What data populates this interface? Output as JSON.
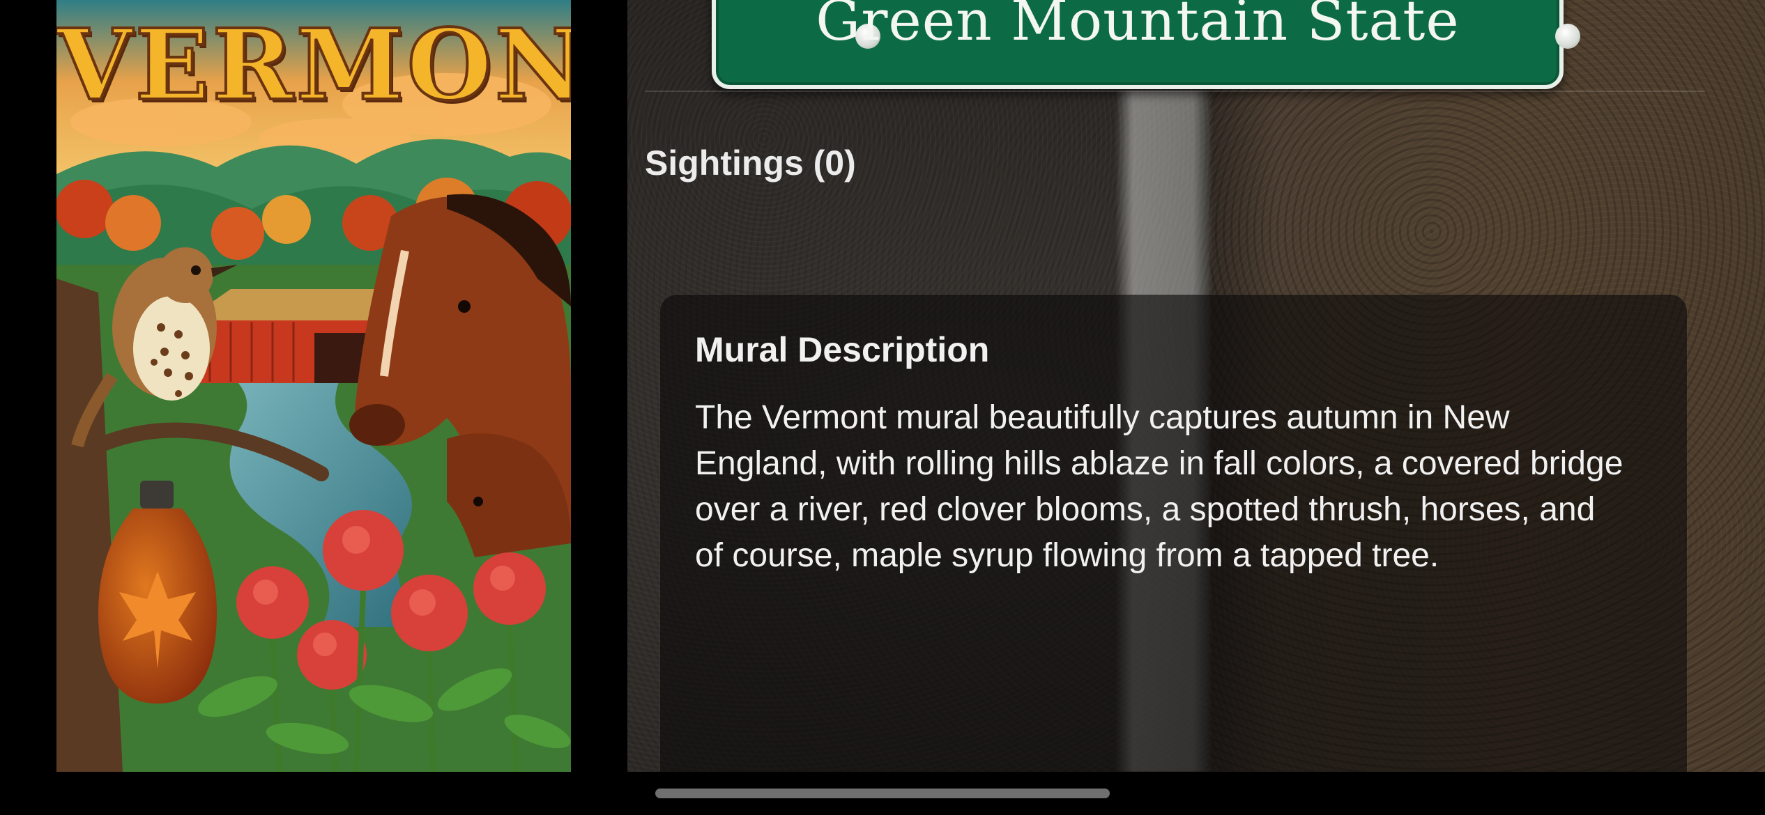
{
  "mural": {
    "title": "VERMONT",
    "image_name": "vermont-autumn-mural"
  },
  "sign": {
    "nickname": "Green Mountain State",
    "color": "#0c6b44"
  },
  "sightings": {
    "label": "Sightings (0)"
  },
  "description": {
    "heading": "Mural Description",
    "body": "The Vermont mural beautifully captures autumn in New England, with rolling hills ablaze in fall colors, a covered bridge over a river, red clover blooms, a spotted thrush, horses, and of course, maple syrup flowing from a tapped tree."
  }
}
